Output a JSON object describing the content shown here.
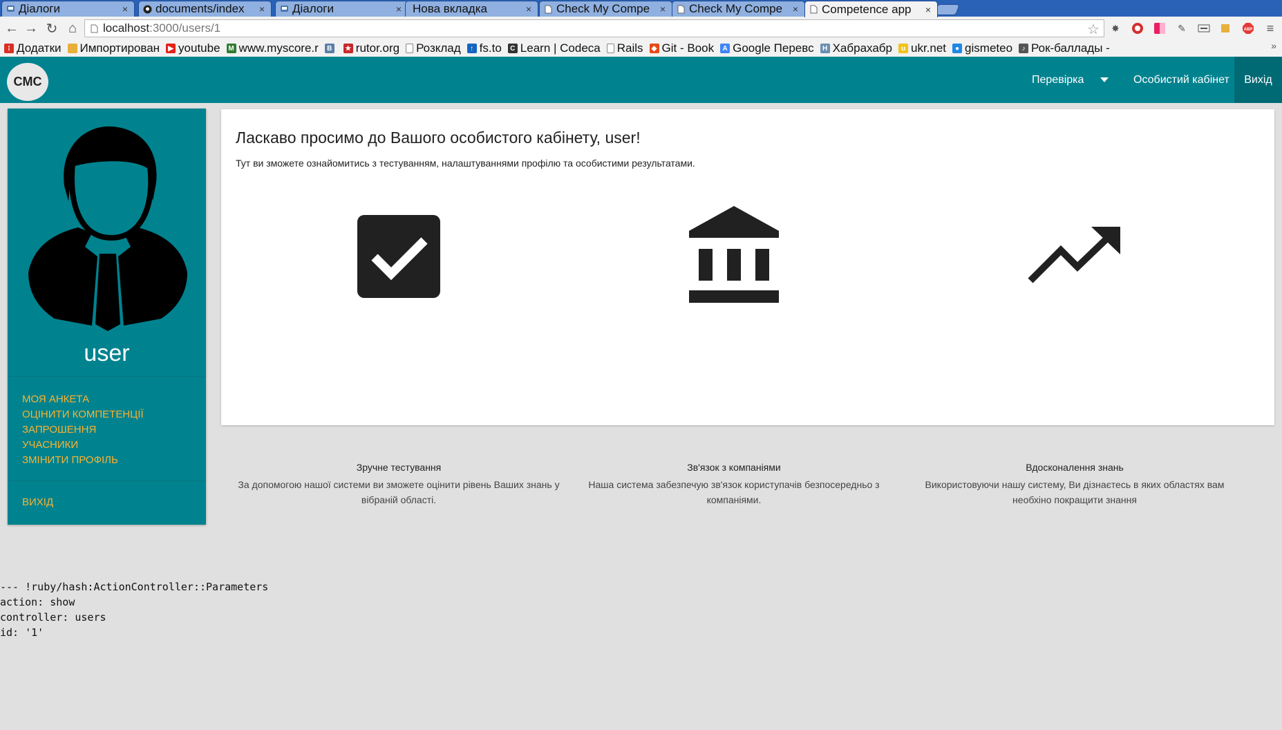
{
  "tabs": [
    {
      "title": "Діалоги",
      "icon": "chat-icon",
      "active": false
    },
    {
      "title": "documents/index",
      "icon": "github-icon",
      "active": false
    },
    {
      "title": "Діалоги",
      "icon": "chat-icon",
      "active": false
    },
    {
      "title": "Нова вкладка",
      "icon": "",
      "active": false
    },
    {
      "title": "Check My Compe",
      "icon": "page-icon",
      "active": false
    },
    {
      "title": "Check My Compe",
      "icon": "page-icon",
      "active": false
    },
    {
      "title": "Competence app",
      "icon": "page-icon",
      "active": true
    }
  ],
  "url": {
    "host": "localhost",
    "path": ":3000/users/1"
  },
  "bookmarks": [
    {
      "label": "Додатки",
      "icon": "apps-grid-icon",
      "color": "#d93025"
    },
    {
      "label": "Импортирован",
      "icon": "folder-icon",
      "color": "#e8b03a"
    },
    {
      "label": "youtube",
      "icon": "youtube-icon",
      "color": "#e62117"
    },
    {
      "label": "www.myscore.r",
      "icon": "myscore-icon",
      "color": "#2e7d32"
    },
    {
      "label": "",
      "icon": "vk-icon",
      "color": "#5b7fa6"
    },
    {
      "label": "rutor.org",
      "icon": "rutor-icon",
      "color": "#c62828"
    },
    {
      "label": "Розклад",
      "icon": "page-icon",
      "color": "#888888"
    },
    {
      "label": "fs.to",
      "icon": "arrow-up-icon",
      "color": "#1565c0"
    },
    {
      "label": "Learn | Codeca",
      "icon": "codecademy-icon",
      "color": "#333333"
    },
    {
      "label": "Rails",
      "icon": "page-icon",
      "color": "#888888"
    },
    {
      "label": "Git - Book",
      "icon": "git-icon",
      "color": "#e64a19"
    },
    {
      "label": "Google Перевс",
      "icon": "translate-icon",
      "color": "#4285f4"
    },
    {
      "label": "Хабрахабр",
      "icon": "habr-icon",
      "color": "#6a8fb0"
    },
    {
      "label": "ukr.net",
      "icon": "ukrnet-icon",
      "color": "#f0c419"
    },
    {
      "label": "gismeteo",
      "icon": "drop-icon",
      "color": "#1e88e5"
    },
    {
      "label": "Рок-баллады -",
      "icon": "rock-icon",
      "color": "#555555"
    }
  ],
  "app": {
    "logo": "CMC",
    "nav": {
      "check": "Перевірка",
      "cabinet": "Особистий кабінет",
      "logout": "Вихід"
    },
    "sidebar": {
      "username": "user",
      "menu": [
        "МОЯ АНКЕТА",
        "ОЦІНИТИ КОМПЕТЕНЦІЇ",
        "ЗАПРОШЕННЯ",
        "УЧАСНИКИ",
        "ЗМІНИТИ ПРОФІЛЬ"
      ],
      "logout": "ВИХІД"
    },
    "welcome": {
      "title": "Ласкаво просимо до Вашого особистого кабінету, user!",
      "subtitle": "Тут ви зможете ознайомитись з тестуванням, налаштуваннями профілю та особистими результатами."
    },
    "features": [
      {
        "icon": "checkbox-icon",
        "title": "Зручне тестування",
        "text": "За допомогою нашої системи ви зможете оцінити рівень Ваших знань у вібраній області."
      },
      {
        "icon": "bank-icon",
        "title": "Зв'язок з компаніями",
        "text": "Наша система забезпечую зв'язок користупачів безпосередньо з компаніями."
      },
      {
        "icon": "trending-up-icon",
        "title": "Вдосконалення знань",
        "text": "Використовуючи нашу систему, Ви дізнаєтесь в яких областях вам необхіно покращити знання"
      }
    ]
  },
  "debug": [
    "--- !ruby/hash:ActionController::Parameters",
    "action: show",
    "controller: users",
    "id: '1'"
  ],
  "colors": {
    "teal": "#00838f",
    "orange": "#f9b233",
    "tab_bar": "#2a62b8",
    "page_bg": "#e0e0e0"
  }
}
